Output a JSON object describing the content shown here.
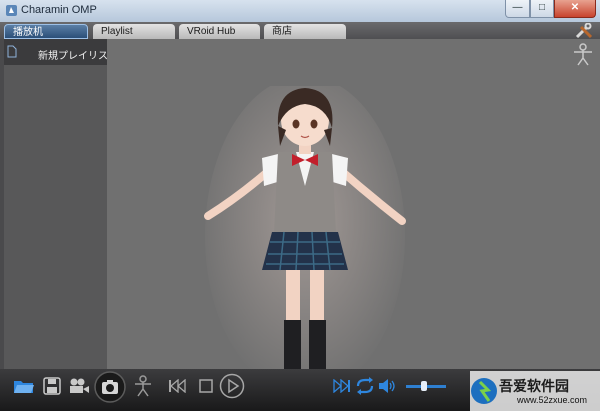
{
  "app": {
    "title": "Charamin OMP"
  },
  "window_buttons": {
    "minimize": "—",
    "maximize": "□",
    "close": "✕"
  },
  "tabs": [
    {
      "label": "播放机",
      "active": true
    },
    {
      "label": "Playlist",
      "active": false
    },
    {
      "label": "VRoid Hub",
      "active": false
    },
    {
      "label": "商店",
      "active": false
    }
  ],
  "sidebar": {
    "playlist_label": "新規プレイリスト"
  },
  "controls": {
    "icons": [
      "folder-open-icon",
      "save-icon",
      "video-camera-icon",
      "camera-icon",
      "pose-icon",
      "previous-icon",
      "stop-icon",
      "play-icon",
      "next-icon",
      "repeat-icon",
      "volume-icon",
      "settings-icon"
    ],
    "accent": "#2e86de",
    "volume_level": 0.45
  },
  "watermark": {
    "text": "吾爱软件园",
    "url": "www.52zxue.com"
  }
}
